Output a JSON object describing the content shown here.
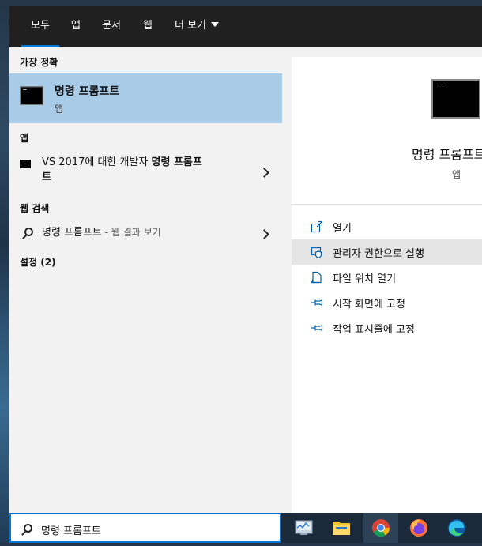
{
  "tabs": [
    {
      "label": "모두",
      "active": true
    },
    {
      "label": "앱"
    },
    {
      "label": "문서"
    },
    {
      "label": "웹"
    },
    {
      "label": "더 보기"
    }
  ],
  "left": {
    "best_match_header": "가장 정확",
    "best_match": {
      "title": "명령 프롬프트",
      "subtitle": "앱",
      "icon": "command-prompt-icon"
    },
    "apps_header": "앱",
    "apps": [
      {
        "prefix": "VS 2017에 대한 개발자 ",
        "bold": "명령 프롬프",
        "line2": "트",
        "icon": "command-prompt-icon"
      }
    ],
    "web_header": "웹 검색",
    "web": {
      "query": "명령 프롬프트",
      "suffix": " - 웹 결과 보기",
      "icon": "search-icon"
    },
    "settings_header": "설정 (2)"
  },
  "right": {
    "title": "명령 프롬프트",
    "subtitle": "앱",
    "actions": [
      {
        "label": "열기",
        "icon": "open-icon"
      },
      {
        "label": "관리자 권한으로 실행",
        "icon": "admin-shield-icon",
        "hover": true
      },
      {
        "label": "파일 위치 열기",
        "icon": "file-location-icon"
      },
      {
        "label": "시작 화면에 고정",
        "icon": "pin-icon"
      },
      {
        "label": "작업 표시줄에 고정",
        "icon": "pin-icon"
      }
    ]
  },
  "search": {
    "value": "명령 프롬프트",
    "icon": "search-icon"
  },
  "taskbar": {
    "items": [
      {
        "name": "task-manager-icon"
      },
      {
        "name": "file-explorer-icon"
      },
      {
        "name": "chrome-icon",
        "active": true
      },
      {
        "name": "firefox-icon"
      },
      {
        "name": "edge-icon"
      }
    ]
  },
  "colors": {
    "accent": "#0078d7",
    "selection": "#a8cbe8",
    "tabbar": "#202020",
    "hover": "#e5e5e5"
  }
}
